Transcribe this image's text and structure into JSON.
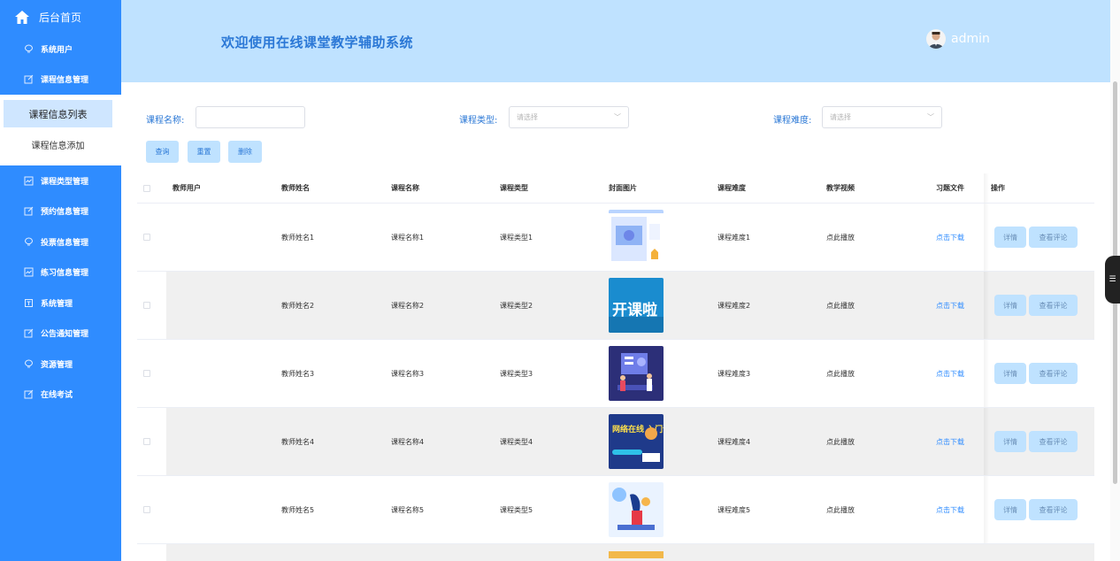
{
  "sidebar": {
    "brand": "后台首页",
    "items": [
      {
        "label": "系统用户",
        "icon": "bulb-icon"
      },
      {
        "label": "课程信息管理",
        "icon": "edit-icon"
      }
    ],
    "submenu": [
      {
        "label": "课程信息列表",
        "active": true
      },
      {
        "label": "课程信息添加",
        "active": false
      }
    ],
    "items2": [
      {
        "label": "课程类型管理",
        "icon": "chart-icon"
      },
      {
        "label": "预约信息管理",
        "icon": "edit-icon"
      },
      {
        "label": "投票信息管理",
        "icon": "bulb-icon"
      },
      {
        "label": "练习信息管理",
        "icon": "chart-icon"
      },
      {
        "label": "系统管理",
        "icon": "box-icon"
      },
      {
        "label": "公告通知管理",
        "icon": "edit-icon"
      },
      {
        "label": "资源管理",
        "icon": "bulb-icon"
      },
      {
        "label": "在线考试",
        "icon": "edit-icon"
      }
    ]
  },
  "header": {
    "title": "欢迎使用在线课堂教学辅助系统",
    "username": "admin"
  },
  "filters": {
    "course_name_label": "课程名称:",
    "course_type_label": "课程类型:",
    "course_type_placeholder": "请选择",
    "difficulty_label": "课程难度:",
    "difficulty_placeholder": "请选择",
    "query": "查询",
    "reset": "重置",
    "delete": "删除"
  },
  "table": {
    "headers": {
      "teacher_user": "教师用户",
      "teacher_name": "教师姓名",
      "course_name": "课程名称",
      "course_type": "课程类型",
      "cover": "封面图片",
      "difficulty": "课程难度",
      "video": "教学视频",
      "exercise": "习题文件",
      "actions": "操作"
    },
    "detail_label": "详情",
    "comments_label": "查看评论",
    "rows": [
      {
        "teacher_user": "",
        "teacher_name": "教师姓名1",
        "course_name": "课程名称1",
        "course_type": "课程类型1",
        "difficulty": "课程难度1",
        "video": "点此播放",
        "exercise": "点击下载"
      },
      {
        "teacher_user": "",
        "teacher_name": "教师姓名2",
        "course_name": "课程名称2",
        "course_type": "课程类型2",
        "difficulty": "课程难度2",
        "video": "点此播放",
        "exercise": "点击下载"
      },
      {
        "teacher_user": "",
        "teacher_name": "教师姓名3",
        "course_name": "课程名称3",
        "course_type": "课程类型3",
        "difficulty": "课程难度3",
        "video": "点此播放",
        "exercise": "点击下载"
      },
      {
        "teacher_user": "",
        "teacher_name": "教师姓名4",
        "course_name": "课程名称4",
        "course_type": "课程类型4",
        "difficulty": "课程难度4",
        "video": "点此播放",
        "exercise": "点击下载"
      },
      {
        "teacher_user": "",
        "teacher_name": "教师姓名5",
        "course_name": "课程名称5",
        "course_type": "课程类型5",
        "difficulty": "课程难度5",
        "video": "点此播放",
        "exercise": "点击下载"
      }
    ],
    "cover_banners": [
      "",
      "开课啦",
      "",
      "网络在线 入门课程",
      ""
    ]
  },
  "colors": {
    "sidebar": "#2f8cff",
    "header": "#bfe2ff",
    "accent": "#2b78d6",
    "button": "#bfe2ff"
  }
}
